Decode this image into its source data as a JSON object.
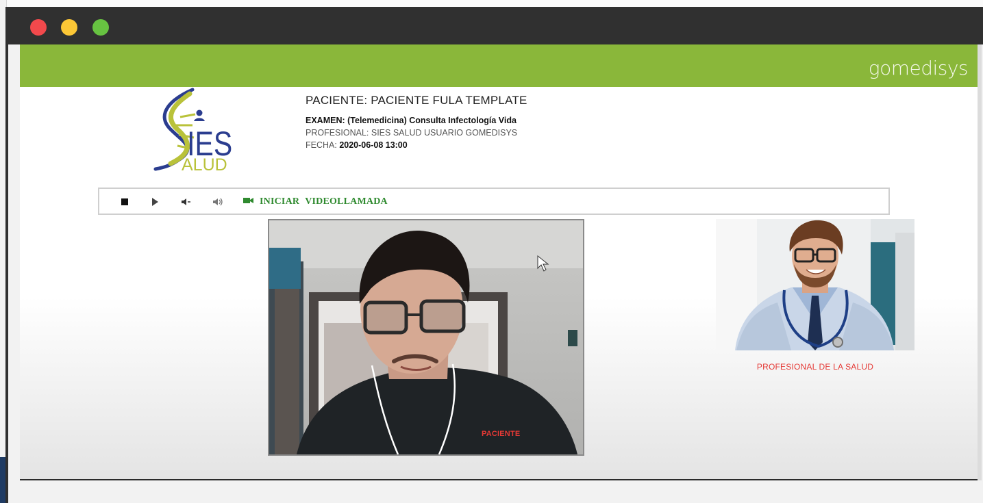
{
  "window": {
    "controls": [
      "close",
      "minimize",
      "maximize"
    ]
  },
  "brand": {
    "name": "gomedisys"
  },
  "logo": {
    "text_main": "IES",
    "text_sub": "ALUD",
    "icons": "sies-salud-logo"
  },
  "patient_info": {
    "title": "PACIENTE: PACIENTE FULA TEMPLATE",
    "exam_label": "EXAMEN:",
    "exam_value": "(Telemedicina) Consulta Infectología Vida",
    "professional_label": "PROFESIONAL:",
    "professional_value": "SIES SALUD USUARIO GOMEDISYS",
    "date_label": "FECHA:",
    "date_value": "2020-06-08 13:00"
  },
  "toolbar": {
    "icons": [
      "stop-icon",
      "play-icon",
      "volume-down-icon",
      "volume-up-icon",
      "video-camera-icon"
    ],
    "start_label_1": "INICIAR",
    "start_label_2": "VIDEOLLAMADA"
  },
  "videos": {
    "patient_caption": "PACIENTE",
    "professional_caption": "PROFESIONAL DE LA SALUD"
  },
  "colors": {
    "header_green": "#8ab73a",
    "caption_red": "#e53935",
    "action_green": "#2f8a2f",
    "titlebar": "#303030"
  }
}
